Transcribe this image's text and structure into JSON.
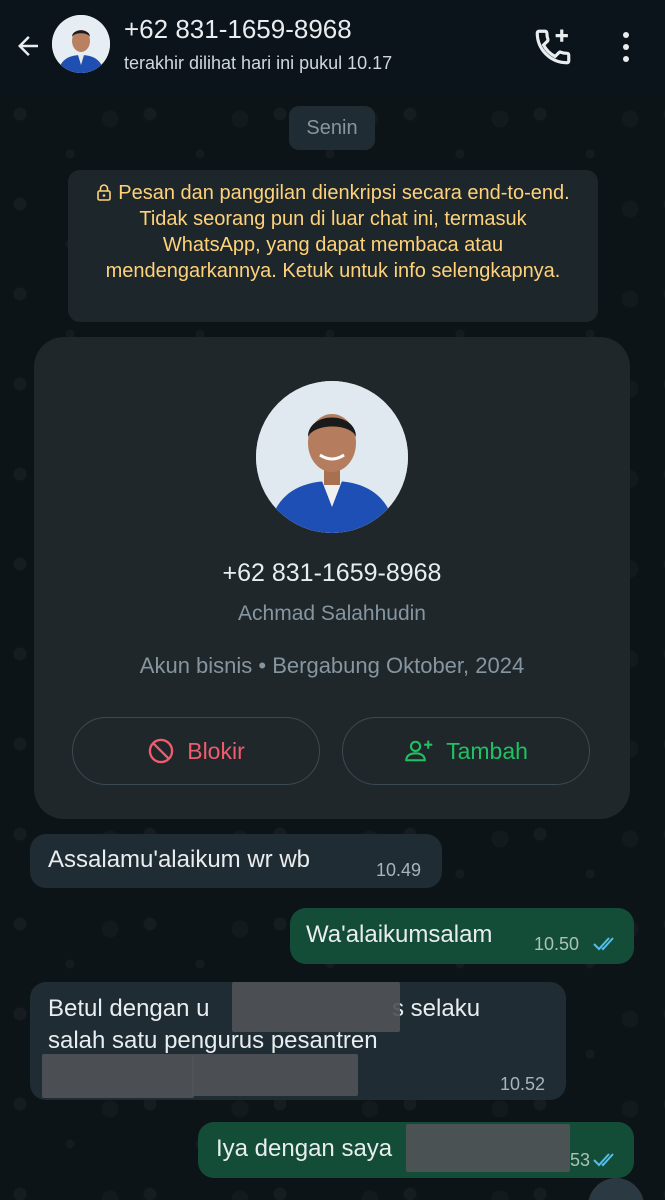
{
  "header": {
    "contact_number": "+62 831-1659-8968",
    "last_seen": "terakhir dilihat hari ini pukul 10.17"
  },
  "date_chip": "Senin",
  "encryption_notice": "Pesan dan panggilan dienkripsi secara end-to-end. Tidak seorang pun di luar chat ini, termasuk WhatsApp, yang dapat membaca atau mendengarkannya. Ketuk untuk info selengkapnya.",
  "profile_card": {
    "phone": "+62 831-1659-8968",
    "name": "Achmad Salahhudin",
    "meta": "Akun bisnis • Bergabung Oktober, 2024",
    "block_label": "Blokir",
    "add_label": "Tambah"
  },
  "messages": [
    {
      "direction": "in",
      "text": "Assalamu'alaikum wr wb",
      "time": "10.49"
    },
    {
      "direction": "out",
      "text": "Wa'alaikumsalam",
      "time": "10.50",
      "status": "read"
    },
    {
      "direction": "in",
      "line1": "Betul dengan u",
      "line1_end": "s selaku",
      "line2": "salah satu pengurus pesantren",
      "time": "10.52"
    },
    {
      "direction": "out",
      "text": "Iya dengan saya",
      "time_partial": "53",
      "status": "read"
    }
  ],
  "colors": {
    "accent_green": "#21c063",
    "danger_red": "#f15c6d",
    "read_tick": "#53bdeb",
    "notice_yellow": "#ffd279"
  },
  "icons": [
    "back-arrow-icon",
    "add-call-icon",
    "more-vert-icon",
    "lock-icon",
    "block-icon",
    "add-person-icon",
    "double-tick-icon"
  ]
}
